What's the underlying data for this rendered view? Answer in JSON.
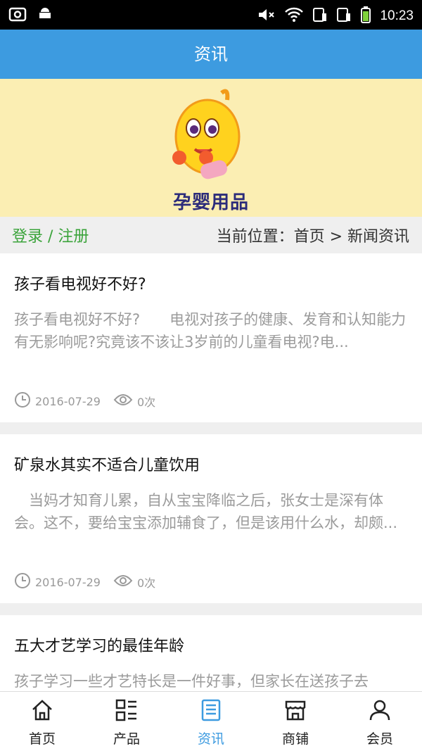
{
  "statusbar": {
    "time": "10:23"
  },
  "header": {
    "title": "资讯"
  },
  "banner": {
    "logo_text": "孕婴用品"
  },
  "location": {
    "login_label": "登录 / 注册",
    "path": "当前位置：首页 > 新闻资讯"
  },
  "articles": [
    {
      "title": "孩子看电视好不好?",
      "summary": "孩子看电视好不好?　　电视对孩子的健康、发育和认知能力有无影响呢?究竟该不该让3岁前的儿童看电视?电...",
      "date": "2016-07-29",
      "views": "0次"
    },
    {
      "title": "矿泉水其实不适合儿童饮用",
      "summary": "　当妈才知育儿累，自从宝宝降临之后，张女士是深有体会。这不，要给宝宝添加辅食了，但是该用什么水，却颇...",
      "date": "2016-07-29",
      "views": "0次"
    },
    {
      "title": "五大才艺学习的最佳年龄",
      "summary": "孩子学习一些才艺特长是一件好事，但家长在送孩子去",
      "date": "",
      "views": ""
    }
  ],
  "tabs": [
    {
      "label": "首页",
      "icon": "home-icon"
    },
    {
      "label": "产品",
      "icon": "grid-list-icon"
    },
    {
      "label": "资讯",
      "icon": "news-icon",
      "active": true
    },
    {
      "label": "商铺",
      "icon": "store-icon"
    },
    {
      "label": "会员",
      "icon": "user-icon"
    }
  ],
  "colors": {
    "primary": "#3d9be0",
    "banner": "#fbeeb3",
    "login": "#3aa33a"
  }
}
